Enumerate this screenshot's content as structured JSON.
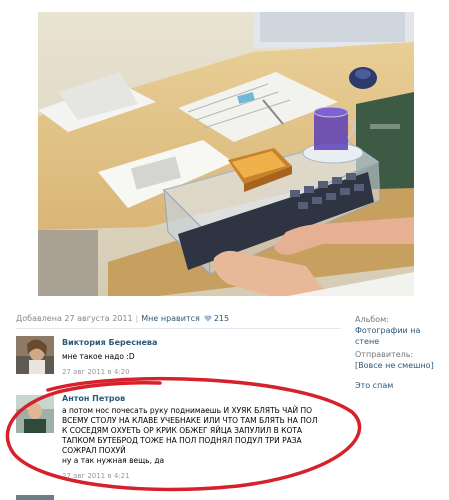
{
  "post": {
    "added": "Добавлена 27 августа 2011",
    "separator": "|",
    "like_label": "Мне нравится",
    "like_count": "215"
  },
  "sidebar": {
    "album_label": "Альбом:",
    "album_value": "Фотографии на стене",
    "sender_label": "Отправитель:",
    "sender_value": "[Вовсе не смешно]",
    "spam": "Это спам"
  },
  "comments": [
    {
      "name": "Виктория Береснева",
      "lines": [
        "мне такое надо :D"
      ],
      "date": "27 авг 2011 в 4:20"
    },
    {
      "name": "Антон Петров",
      "lines": [
        "а потом нос почесать руку поднимаешь И ХУЯК БЛЯТЬ ЧАЙ ПО",
        "ВСЕМУ СТОЛУ НА КЛАВЕ УЧЕБНАКЕ ИЛИ ЧТО ТАМ БЛЯТЬ НА ПОЛ",
        "К СОСЕДЯМ ОХУЕТЬ ОР КРИК ОБЖЕГ ЯЙЦА ЗАПУЛИЛ В КОТА",
        "ТАПКОМ БУТЕБРОД ТОЖЕ НА ПОЛ ПОДНЯЛ ПОДУЛ ТРИ РАЗА",
        "СОЖРАЛ ПОХУЙ",
        "ну а так нужная вещь, да"
      ],
      "date": "27 авг 2011 в 4:21"
    }
  ],
  "colors": {
    "link": "#2b587a",
    "circle": "#d6202a",
    "muted": "#888888"
  }
}
